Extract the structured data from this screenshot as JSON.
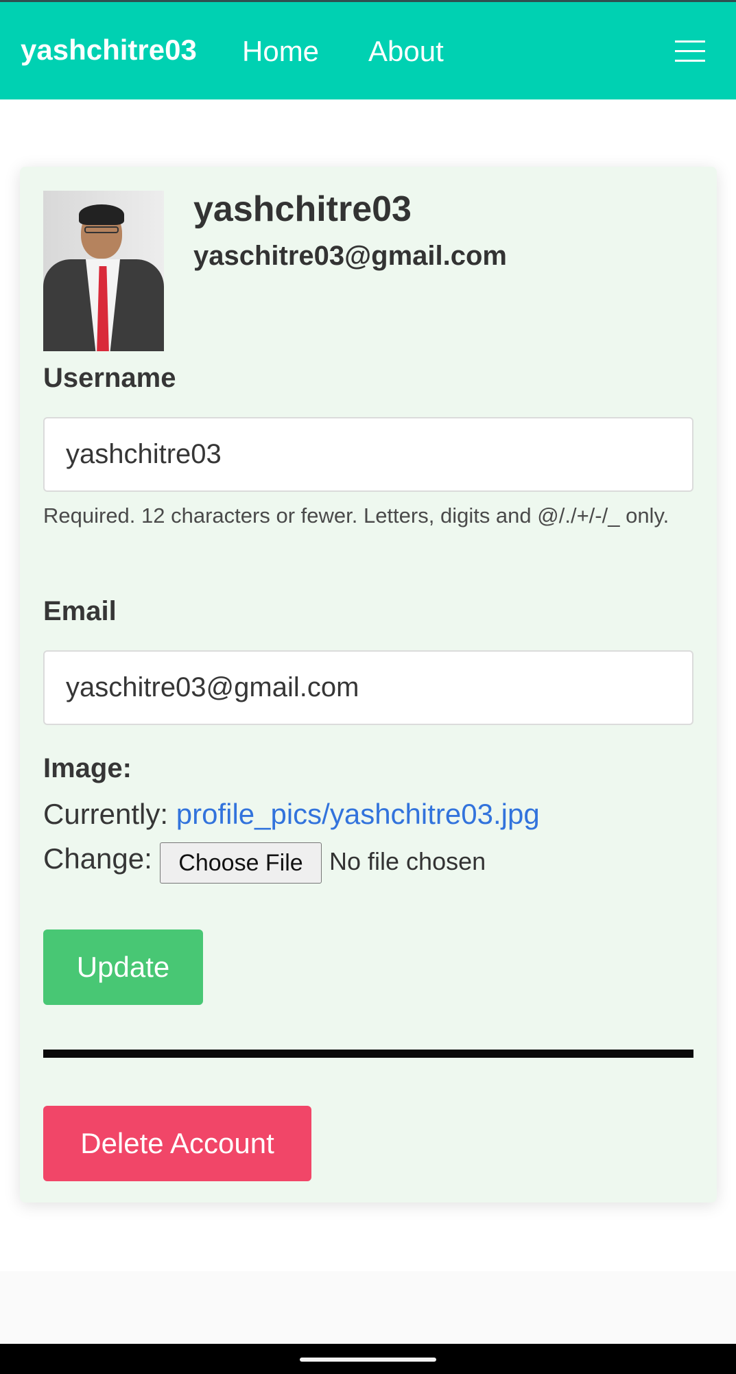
{
  "navbar": {
    "brand": "yashchitre03",
    "links": [
      "Home",
      "About"
    ],
    "menu_icon": "hamburger-menu-icon",
    "background": "#00d1b2"
  },
  "profile": {
    "name": "yashchitre03",
    "email": "yaschitre03@gmail.com",
    "avatar": "profile-photo"
  },
  "form": {
    "username_label": "Username",
    "username_value": "yashchitre03",
    "username_help": "Required. 12 characters or fewer. Letters, digits and @/./+/-/_ only.",
    "email_label": "Email",
    "email_value": "yaschitre03@gmail.com",
    "image_label": "Image:",
    "currently_label": "Currently:",
    "current_image": "profile_pics/yashchitre03.jpg",
    "change_label": "Change:",
    "file_button": "Choose File",
    "file_status": "No file chosen",
    "update_button": "Update",
    "delete_button": "Delete Account"
  },
  "colors": {
    "primary": "#00d1b2",
    "success": "#48c774",
    "danger": "#f14668",
    "link": "#3273dc",
    "card": "#eef8ef"
  }
}
